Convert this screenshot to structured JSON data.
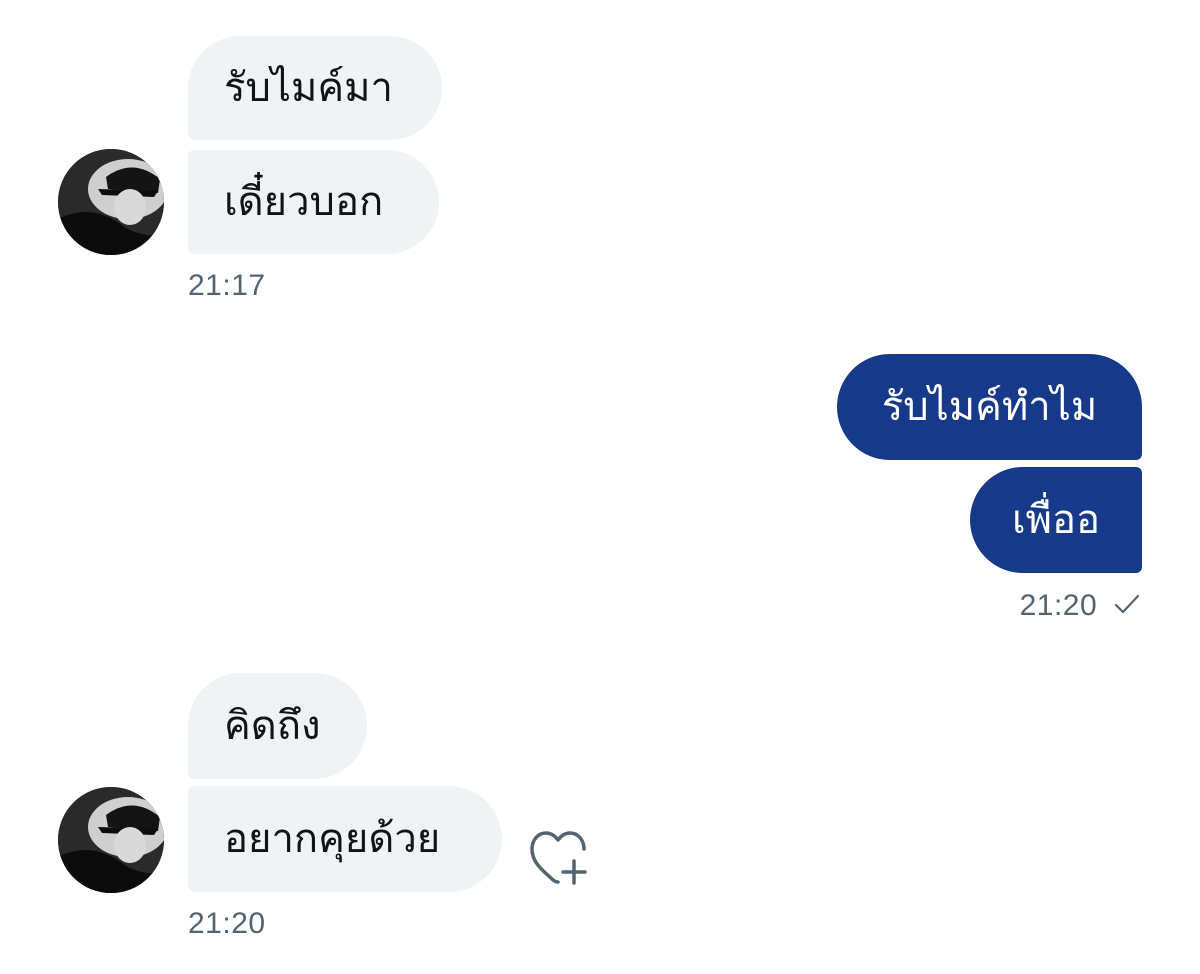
{
  "messages": [
    {
      "side": "in",
      "text": "รับไมค์มา"
    },
    {
      "side": "in",
      "text": "เดี๋ยวบอก"
    },
    {
      "side": "in_time",
      "text": "21:17"
    },
    {
      "side": "out",
      "text": "รับไมค์ทำไม"
    },
    {
      "side": "out",
      "text": "เพื่ออ"
    },
    {
      "side": "out_time",
      "text": "21:20"
    },
    {
      "side": "in",
      "text": "คิดถึง"
    },
    {
      "side": "in",
      "text": "อยากคุยด้วย"
    },
    {
      "side": "in_time",
      "text": "21:20"
    }
  ],
  "icons": {
    "avatar": "avatar",
    "sent_status": "checkmark-icon",
    "reaction": "heart-plus-icon"
  },
  "colors": {
    "incoming_bubble": "#eff3f4",
    "outgoing_bubble": "#17398a",
    "timestamp": "#536471"
  }
}
